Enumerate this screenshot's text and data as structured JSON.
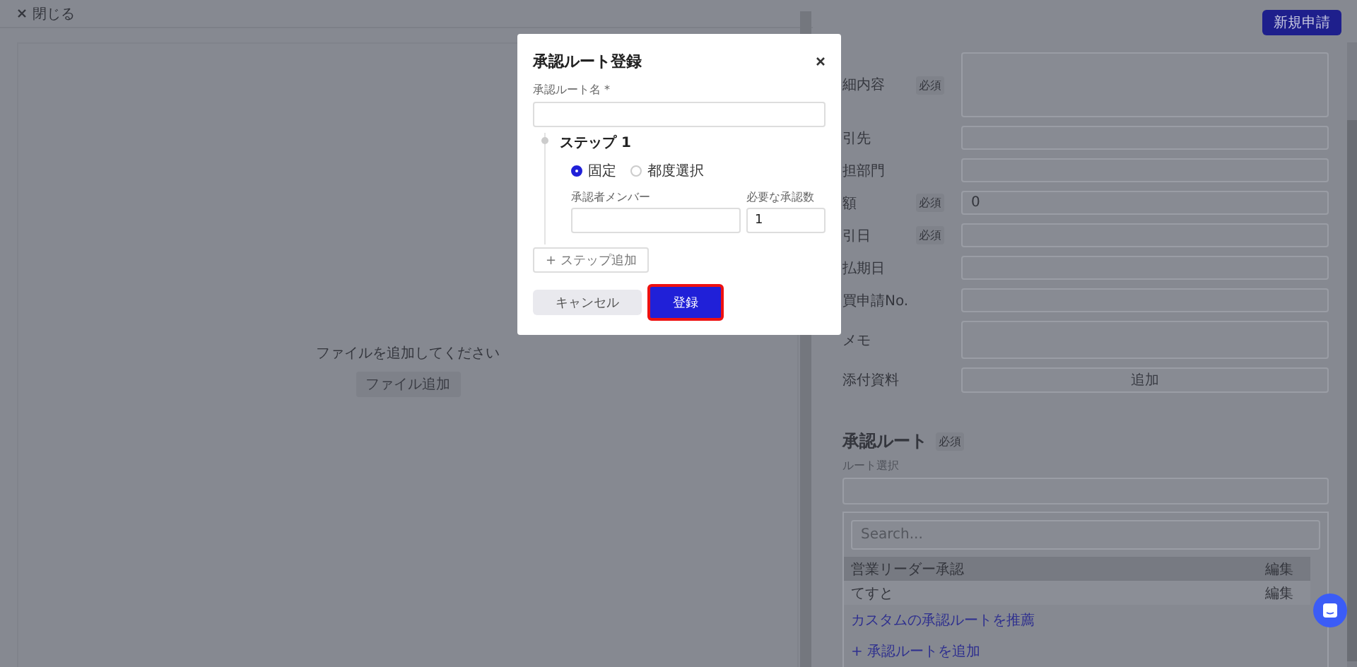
{
  "top_bar": {
    "close_label": "閉じる"
  },
  "new_request_button": "新規申請",
  "file_panel": {
    "message": "ファイルを追加してください",
    "button": "ファイル追加"
  },
  "form": {
    "fields": [
      {
        "label": "細内容",
        "kind": "textarea",
        "badge": "必須"
      },
      {
        "label": "引先",
        "kind": "text"
      },
      {
        "label": "担部門",
        "kind": "text"
      },
      {
        "label": "額",
        "kind": "text",
        "badge": "必須",
        "value": "0"
      },
      {
        "label": "引日",
        "kind": "text",
        "badge": "必須"
      },
      {
        "label": "払期日",
        "kind": "text"
      },
      {
        "label": "買申請No.",
        "kind": "text"
      },
      {
        "label": "メモ",
        "kind": "textarea"
      },
      {
        "label": "添付資料",
        "kind": "button",
        "button": "追加"
      }
    ]
  },
  "approval_route": {
    "title": "承認ルート",
    "badge": "必須",
    "select_label": "ルート選択",
    "search_placeholder": "Search...",
    "routes": [
      {
        "name": "営業リーダー承認",
        "action": "編集",
        "selected": true
      },
      {
        "name": "てすと",
        "action": "編集",
        "selected": false
      }
    ],
    "links": [
      "カスタムの承認ルートを推薦",
      "+ 承認ルートを追加"
    ]
  },
  "modal": {
    "title": "承認ルート登録",
    "name_label": "承認ルート名",
    "required_mark": "*",
    "step": {
      "title": "ステップ 1",
      "options": [
        {
          "label": "固定",
          "selected": true
        },
        {
          "label": "都度選択",
          "selected": false
        }
      ],
      "member_label": "承認者メンバー",
      "count_label": "必要な承認数",
      "count_value": "1"
    },
    "add_step_button": "+ ステップ追加",
    "buttons": [
      {
        "label": "キャンセル",
        "kind": "secondary",
        "highlighted": false
      },
      {
        "label": "登録",
        "kind": "primary",
        "highlighted": true
      }
    ]
  }
}
